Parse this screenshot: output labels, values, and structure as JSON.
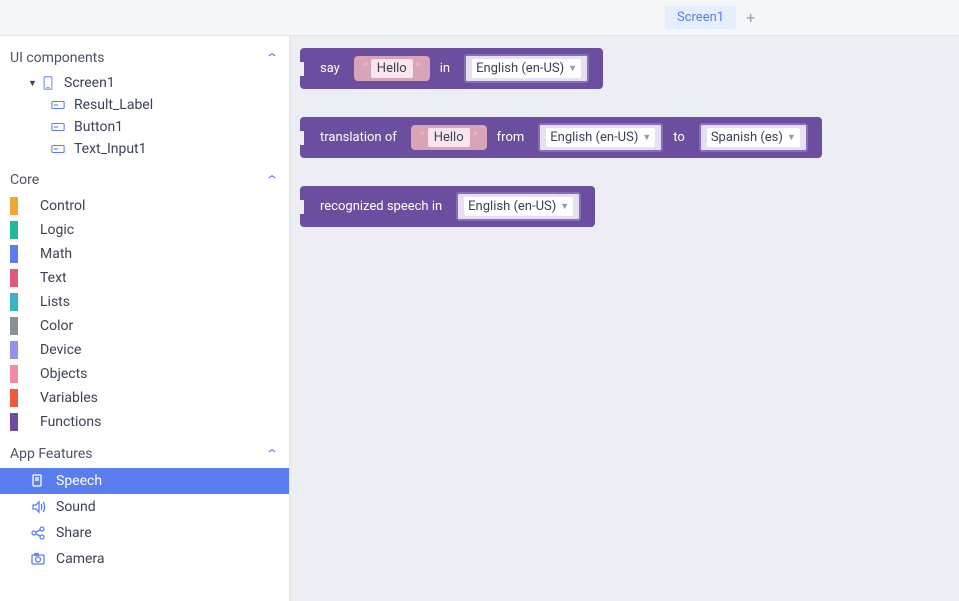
{
  "header": {
    "tab": "Screen1"
  },
  "sidebar": {
    "ui_components": {
      "title": "UI components",
      "screen": "Screen1",
      "children": [
        "Result_Label",
        "Button1",
        "Text_Input1"
      ]
    },
    "core": {
      "title": "Core",
      "items": [
        {
          "label": "Control",
          "color": "#f0a830"
        },
        {
          "label": "Logic",
          "color": "#1eb89a"
        },
        {
          "label": "Math",
          "color": "#5a7ef0"
        },
        {
          "label": "Text",
          "color": "#e05a7a"
        },
        {
          "label": "Lists",
          "color": "#3ab3c9"
        },
        {
          "label": "Color",
          "color": "#8a8f99"
        },
        {
          "label": "Device",
          "color": "#9590e8"
        },
        {
          "label": "Objects",
          "color": "#f28aa0"
        },
        {
          "label": "Variables",
          "color": "#f05a3c"
        },
        {
          "label": "Functions",
          "color": "#6b4e9e"
        }
      ]
    },
    "app_features": {
      "title": "App Features",
      "items": [
        "Speech",
        "Sound",
        "Share",
        "Camera"
      ],
      "active": "Speech"
    }
  },
  "blocks": {
    "say": {
      "label_say": "say",
      "value": "Hello",
      "label_in": "in",
      "lang": "English (en-US)"
    },
    "translate": {
      "label_trans": "translation of",
      "value": "Hello",
      "label_from": "from",
      "from_lang": "English (en-US)",
      "label_to": "to",
      "to_lang": "Spanish (es)"
    },
    "recognize": {
      "label": "recognized speech in",
      "lang": "English (en-US)"
    }
  }
}
